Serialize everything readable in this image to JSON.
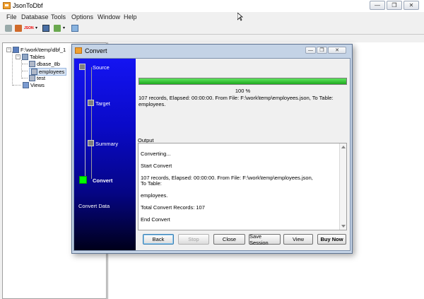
{
  "app": {
    "title": "JsonToDbf",
    "window_controls": [
      "minimize-icon",
      "restore-icon",
      "close-icon"
    ]
  },
  "menu": [
    "File",
    "Database",
    "Tools",
    "Options",
    "Window",
    "Help"
  ],
  "toolbar": {
    "icons": [
      "connect-icon",
      "import-icon",
      "json-icon",
      "dropdown-icon",
      "run-icon",
      "check-icon",
      "dropdown-icon",
      "grid-icon"
    ],
    "json_label": "JSON"
  },
  "tree": {
    "root": "F:\\work\\temp\\dbf_1",
    "tables_label": "Tables",
    "tables": [
      "dbase_8b",
      "employees",
      "test"
    ],
    "views_label": "Views"
  },
  "dialog": {
    "title": "Convert",
    "steps": [
      "Source",
      "Target",
      "Summary",
      "Convert"
    ],
    "active_step": "Convert",
    "sidebar_footer": "Convert Data",
    "progress": {
      "fraction": 1.0,
      "label": "100 %"
    },
    "result_line1": "107 records,   Elapsed: 00:00:00.   From File: F:\\work\\temp\\employees.json,   To Table:",
    "result_line2": "employees.",
    "output_label": "Output",
    "output_lines": [
      "Converting...",
      "Start Convert",
      "107 records,   Elapsed: 00:00:00.   From File: F:\\work\\temp\\employees.json,   To Table:",
      "employees.",
      "Total Convert Records: 107",
      "End Convert"
    ],
    "buttons": {
      "back": "Back",
      "stop": "Stop",
      "close": "Close",
      "save_session": "Save Session",
      "view": "View",
      "buy_now": "Buy Now"
    }
  },
  "colors": {
    "accent_progress": "#2dc42d",
    "sidebar_blue": "#1414f2",
    "active_step": "#00ff00",
    "inactive_step": "#808080"
  }
}
